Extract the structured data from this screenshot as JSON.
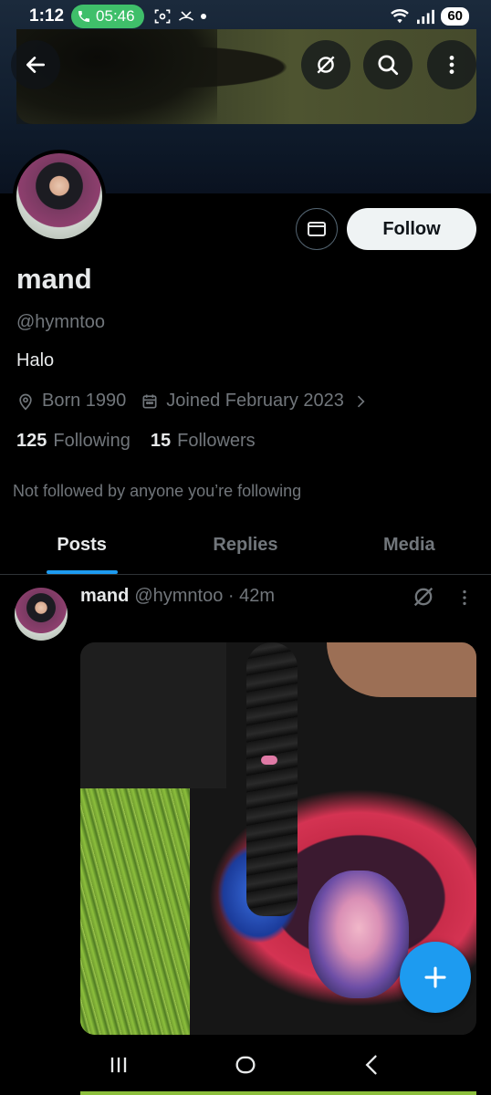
{
  "status_bar": {
    "time": "1:12",
    "call_time": "05:46",
    "battery": "60"
  },
  "profile": {
    "name": "mand",
    "handle": "@hymntoo",
    "bio": "Halo",
    "born": "Born 1990",
    "joined": "Joined February 2023",
    "following_count": "125",
    "following_label": "Following",
    "followers_count": "15",
    "followers_label": "Followers",
    "not_followed_text": "Not followed by anyone you’re following",
    "follow_button": "Follow"
  },
  "tabs": [
    {
      "label": "Posts",
      "active": true
    },
    {
      "label": "Replies",
      "active": false
    },
    {
      "label": "Media",
      "active": false
    }
  ],
  "post": {
    "author_name": "mand",
    "meta": "@hymntoo · 42m"
  },
  "colors": {
    "accent": "#1d9bf0",
    "muted": "#71767b",
    "text": "#e7e9ea",
    "call_green": "#3fbf6a"
  }
}
